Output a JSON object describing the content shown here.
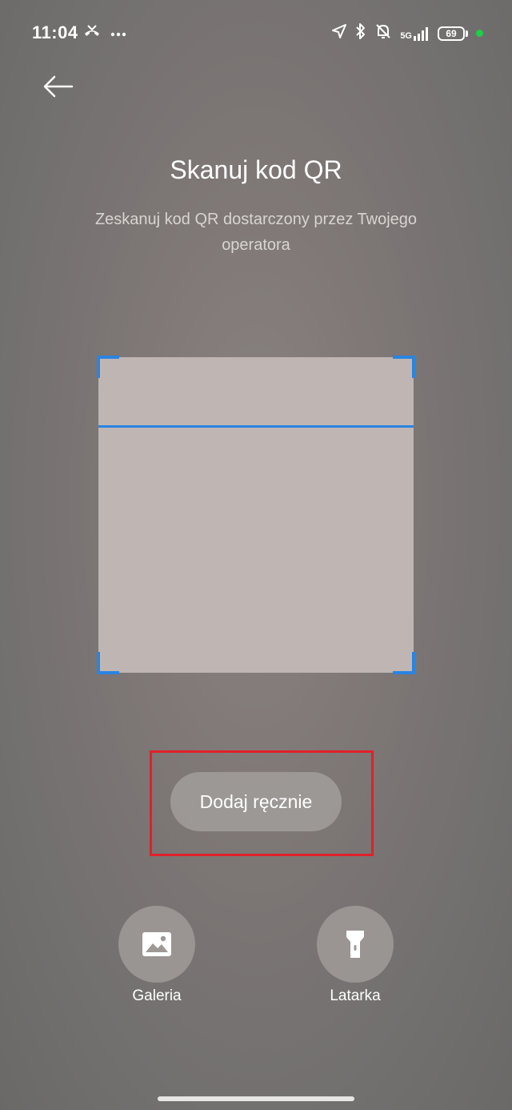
{
  "status_bar": {
    "time": "11:04",
    "network": "5G",
    "battery": "69",
    "icons": [
      "missed-call-icon",
      "more-dots-icon",
      "location-arrow-icon",
      "bluetooth-icon",
      "bell-off-icon",
      "signal-icon",
      "battery-icon"
    ]
  },
  "header": {
    "back_icon": "arrow-left-icon",
    "title": "Skanuj kod QR",
    "subtitle": "Zeskanuj kod QR dostarczony przez Twojego operatora"
  },
  "scanner": {
    "frame_color": "#2a84e0"
  },
  "buttons": {
    "add_manually": "Dodaj ręcznie"
  },
  "actions": {
    "gallery": {
      "label": "Galeria",
      "icon": "image-icon"
    },
    "flashlight": {
      "label": "Latarka",
      "icon": "flashlight-icon"
    }
  },
  "colors": {
    "accent": "#2a84e0",
    "highlight": "#e0212a",
    "status_dot": "#1ecf4a"
  }
}
